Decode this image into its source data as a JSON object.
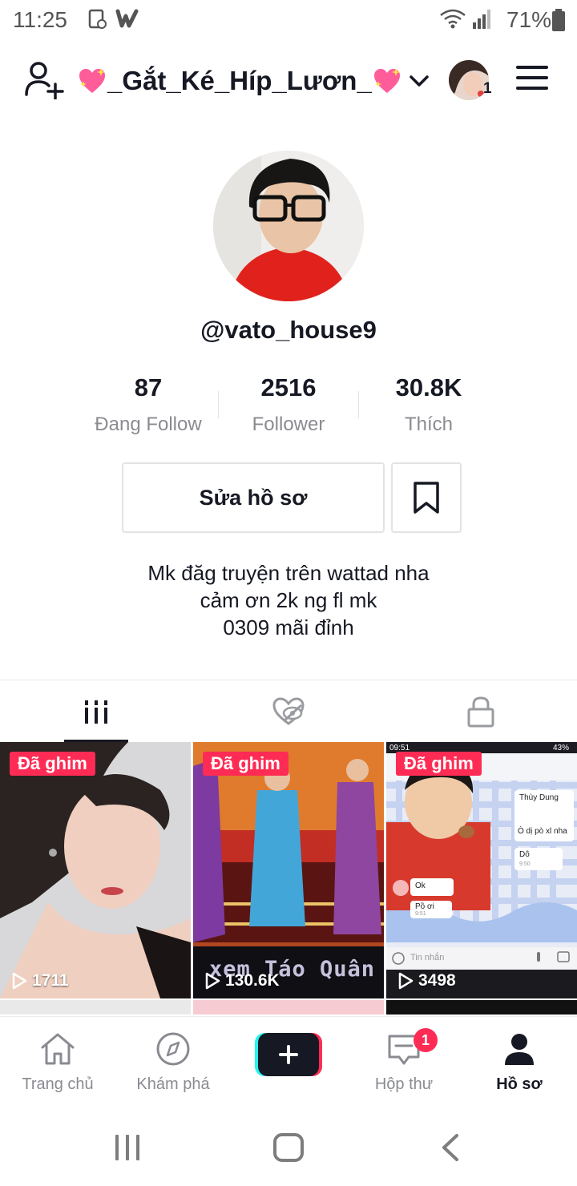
{
  "status_bar": {
    "time": "11:25",
    "battery": "71%"
  },
  "header": {
    "username": "_Gắt_Ké_Híp_Lươn_",
    "account_count": "1"
  },
  "profile": {
    "handle": "@vato_house9",
    "stats": [
      {
        "value": "87",
        "label": "Đang Follow"
      },
      {
        "value": "2516",
        "label": "Follower"
      },
      {
        "value": "30.8K",
        "label": "Thích"
      }
    ],
    "edit_label": "Sửa hồ sơ",
    "bio": [
      "Mk đăg truyện trên wattad nha",
      "cảm ơn 2k ng fl mk",
      "0309 mãi đỉnh"
    ]
  },
  "videos": [
    {
      "pinned": "Đã ghim",
      "plays": "1711"
    },
    {
      "pinned": "Đã ghim",
      "plays": "130.6K",
      "caption": "xem Táo Quân"
    },
    {
      "pinned": "Đã ghim",
      "plays": "3498",
      "screen": {
        "time": "09:51",
        "battery": "43%",
        "contact": "Thùy Dung",
        "messages": [
          "Ò dị pò xl nha",
          "Dô",
          "Ok",
          "Pồ ơi"
        ],
        "timestamps": [
          "9:50",
          "9:51"
        ],
        "input_placeholder": "Tin nhắn"
      }
    }
  ],
  "nav": {
    "home": "Trang chủ",
    "discover": "Khám phá",
    "inbox": "Hộp thư",
    "inbox_badge": "1",
    "profile": "Hồ sơ"
  },
  "colors": {
    "accent": "#fe2c55",
    "cyan": "#25f4ee",
    "text": "#161823",
    "muted": "#8a8b91"
  }
}
